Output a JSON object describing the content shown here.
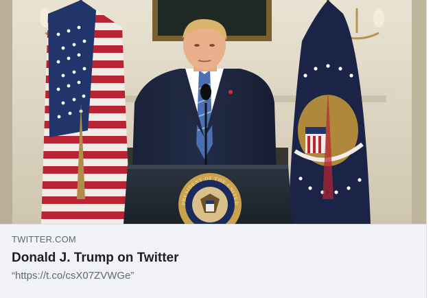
{
  "link_preview": {
    "domain": "TWITTER.COM",
    "title": "Donald J. Trump on Twitter",
    "description": "“https://t.co/csX07ZVWGe”",
    "seal_text": "PRESIDENT OF THE UNITED"
  },
  "colors": {
    "card_background": "#f0f2f5",
    "title_text": "#1c1e21",
    "secondary_text": "#606770",
    "border": "#dadde1"
  }
}
